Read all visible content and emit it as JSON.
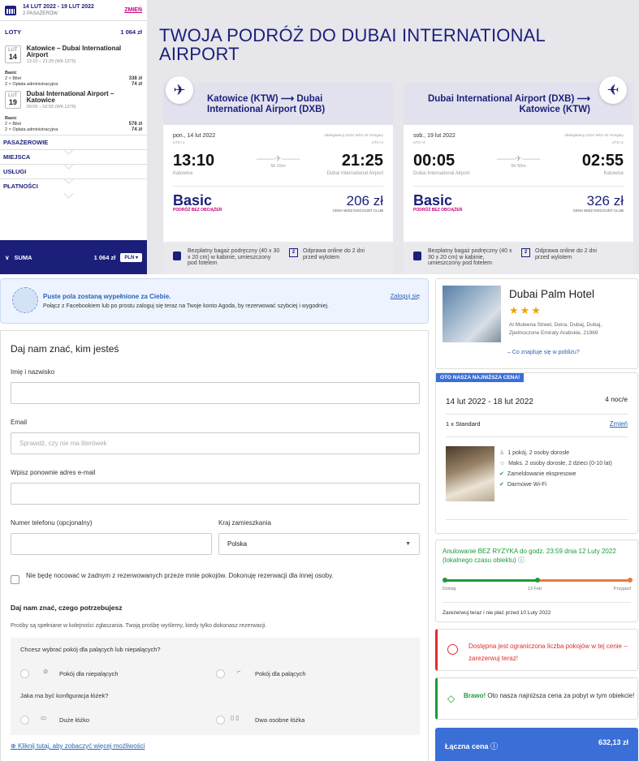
{
  "wizz": {
    "dates": "14 LUT 2022 - 19 LUT 2022",
    "passengers": "2 PASAŻERÓW",
    "change": "ZMIEŃ",
    "flights_label": "LOTY",
    "flights_total": "1 064 zł",
    "legs": [
      {
        "month": "LUT",
        "day": "14",
        "route": "Katowice – Dubai International Airport",
        "time": "13:10 – 21:25 (W6 1275)",
        "fare": "Basic",
        "items": [
          {
            "label": "2 × Bilet",
            "price": "338 zł"
          },
          {
            "label": "2 × Opłata administracyjna",
            "price": "74 zł"
          }
        ]
      },
      {
        "month": "LUT",
        "day": "19",
        "route": "Dubai International Airport – Katowice",
        "time": "00:05 – 02:55 (W6 1276)",
        "fare": "Basic",
        "items": [
          {
            "label": "2 × Bilet",
            "price": "578 zł"
          },
          {
            "label": "2 × Opłata administracyjna",
            "price": "74 zł"
          }
        ]
      }
    ],
    "accordions": [
      "PASAŻEROWIE",
      "MIEJSCA",
      "USŁUGI",
      "PŁATNOŚCI"
    ],
    "sum_label": "SUMA",
    "sum_value": "1 064 zł",
    "currency": "PLN",
    "title": "TWOJA PODRÓŻ DO DUBAI INTERNATIONAL AIRPORT",
    "cards": [
      {
        "header": "Katowice (KTW) ⟶ Dubai International Airport (DXB)",
        "date": "pon., 14 lut 2022",
        "operator": "obsługiwany przez Wizz Air Hungary",
        "utc_dep": "UTC+1",
        "utc_arr": "UTC+4",
        "dep": "13:10",
        "arr": "21:25",
        "duration": "5h 15m",
        "from": "Katowice",
        "to": "Dubai International Airport",
        "fare": "Basic",
        "fare_sub": "PODRÓŻ BEZ OBCIĄŻEŃ",
        "price": "206 zł",
        "price_sub": "CENA WIZZ DISCOUNT CLUB",
        "bag": "Bezpłatny bagaż podręczny (40 x 30 x 20 cm) w kabinie, umieszczony pod fotelem",
        "checkin": "Odprawa online do 2 dni przed wylotem"
      },
      {
        "header": "Dubai International Airport (DXB) ⟶ Katowice (KTW)",
        "date": "sob., 19 lut 2022",
        "operator": "obsługiwany przez Wizz Air Hungary",
        "utc_dep": "UTC+4",
        "utc_arr": "UTC+1",
        "dep": "00:05",
        "arr": "02:55",
        "duration": "5h 50m",
        "from": "Dubai International Airport",
        "to": "Katowice",
        "fare": "Basic",
        "fare_sub": "PODRÓŻ BEZ OBCIĄŻEŃ",
        "price": "326 zł",
        "price_sub": "CENA WIZZ DISCOUNT CLUB",
        "bag": "Bezpłatny bagaż podręczny (40 x 30 x 20 cm) w kabinie, umieszczony pod fotelem",
        "checkin": "Odprawa online do 2 dni przed wylotem"
      }
    ]
  },
  "agoda": {
    "fb_title": "Puste pola zostaną wypełnione za Ciebie.",
    "fb_text": "Połącz z Facebookiem lub po prostu zaloguj się teraz na Twoje konto Agoda, by rezerwować szybciej i wygodniej.",
    "login": "Zaloguj się",
    "form_title": "Daj nam znać, kim jesteś",
    "name_label": "Imię i nazwisko",
    "email_label": "Email",
    "email_placeholder": "Sprawdź, czy nie ma literówek",
    "email2_label": "Wpisz ponownie adres e-mail",
    "phone_label": "Numer telefonu (opcjonalny)",
    "country_label": "Kraj zamieszkania",
    "country_value": "Polska",
    "checkbox_text": "Nie będę nocować w żadnym z rezerwowanych przeze mnie pokojów. Dokonuję rezerwacji dla innej osoby.",
    "needs_title": "Daj nam znać, czego potrzebujesz",
    "needs_sub": "Prośby są spełniane w kolejności zgłaszania. Twoją prośbę wyślemy, kiedy tylko dokonasz rezerwacji.",
    "q1": "Chcesz wybrać pokój dla palących lub niepalących?",
    "nonsmoking": "Pokój dla niepalących",
    "smoking": "Pokój dla palących",
    "q2": "Jaka ma być konfiguracja łóżek?",
    "double_bed": "Duże łóżko",
    "twin_beds": "Dwa osobne łóżka",
    "more": "Kliknij tutaj, aby zobaczyć więcej możliwości",
    "hotel_name": "Dubai Palm Hotel",
    "stars": "★★★",
    "hotel_address": "Al Muteena Street, Deira, Dubaj, Dubaj, Zjednoczone Emiraty Arabskie, 21969",
    "nearby": "– Co znajduje się w pobliżu?",
    "deal_tag": "OTO NASZA NAJNIŻSZA CENA!",
    "stay_dates": "14 lut 2022 - 18 lut 2022",
    "nights": "4 noc/e",
    "room": "1 x Standard",
    "change": "Zmień",
    "features": [
      "1 pokój, 2 osoby dorosłe",
      "Maks. 2 osoby dorosłe, 2 dzieci (0-10 lat)",
      "Zameldowanie ekspresowe",
      "Darmowe Wi-Fi"
    ],
    "cancel_text": "Anulowanie BEZ RYZYKA do godz. 23:59 dnia 12 Luty 2022 (lokalnego czasu obiektu)",
    "timeline": [
      "Dzisiaj",
      "13 Feb",
      "Przyjazd"
    ],
    "pay_note": "Zarezerwuj teraz i nie płać przed 10 Luty 2022",
    "limited": "Dostępna jest ograniczona liczba pokojów w tej cenie – zarezerwuj teraz!",
    "bravo_b": "Brawo!",
    "bravo": "Oto nasza najniższa cena za pobyt w tym obiekcie!",
    "total_label": "Łączna cena",
    "total_value": "632,13 zł"
  },
  "colors": {
    "wizz_navy": "#1b1f7a",
    "wizz_pink": "#c6007e",
    "agoda_blue": "#3a6fd8",
    "green": "#1c9a3c",
    "red": "#e12d2d"
  }
}
